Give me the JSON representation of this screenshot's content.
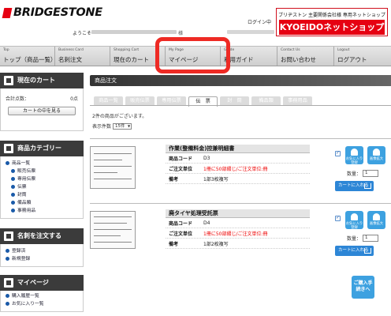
{
  "header": {
    "brand": "BRIDGESTONE",
    "login_label": "ログイン中",
    "welcome": "ようこそ",
    "welcome_suffix": "様",
    "shop_sub": "ブリヂストン 主要関係会社様 専用ネットショップ",
    "shop_name": "KYOEIDOネットショップ"
  },
  "nav": [
    {
      "en": "Top",
      "jp": "トップ（商品一覧）"
    },
    {
      "en": "Business Card",
      "jp": "名刺注文"
    },
    {
      "en": "Shopping Cart",
      "jp": "現在のカート"
    },
    {
      "en": "My Page",
      "jp": "マイページ"
    },
    {
      "en": "Guide",
      "jp": "利用ガイド"
    },
    {
      "en": "Contact Us",
      "jp": "お問い合わせ"
    },
    {
      "en": "Logout",
      "jp": "ログアウト"
    }
  ],
  "sidebar": {
    "cart": {
      "title": "現在のカート",
      "total_label": "合計点数：",
      "total_value": "0点",
      "view_button": "カートの中を見る"
    },
    "category": {
      "title": "商品カテゴリー",
      "items": [
        "商品一覧",
        "販売伝票",
        "専用伝票",
        "伝票",
        "封筒",
        "備品類",
        "事務用品"
      ]
    },
    "meishi": {
      "title": "名刺を注文する",
      "items": [
        "登録済",
        "新規登録"
      ]
    },
    "mypage": {
      "title": "マイページ",
      "items": [
        "購入履歴一覧",
        "お気に入り一覧"
      ]
    }
  },
  "main": {
    "heading": "商品注文",
    "tabs": [
      "商品一覧",
      "販売伝票",
      "専用伝票",
      "伝　票",
      "封　筒",
      "備品類",
      "事務用品"
    ],
    "active_tab": 3,
    "count_text": "2件の商品がございます。",
    "per_page_label": "表示件数",
    "per_page_value": "15件",
    "products": [
      {
        "title": "作業(整備料金)控兼明細書",
        "code_label": "商品コード",
        "code": "D3",
        "unit_label": "ご注文単位",
        "unit": "1冊に50部綴じ/ご注文単位:冊",
        "note_label": "備考",
        "note": "1部3枚複写",
        "qty_label": "数量：",
        "qty": "1",
        "fav_label": "お気に入り登録",
        "zoom_label": "画像拡大",
        "cart_label": "カートに入れる"
      },
      {
        "title": "廃タイヤ処理受託票",
        "code_label": "商品コード",
        "code": "D4",
        "unit_label": "ご注文単位",
        "unit": "1冊に50部綴じ/ご注文単位:冊",
        "note_label": "備考",
        "note": "1部2枚複写",
        "qty_label": "数量：",
        "qty": "1",
        "fav_label": "お気に入り登録",
        "zoom_label": "画像拡大",
        "cart_label": "カートに入れる"
      }
    ],
    "bulk_cart_button": "ご購入手続きへ"
  },
  "colors": {
    "brand_red": "#e60012",
    "highlight": "#ee2a24",
    "accent_blue": "#3da1e0",
    "cart_blue": "#2d86d6"
  }
}
